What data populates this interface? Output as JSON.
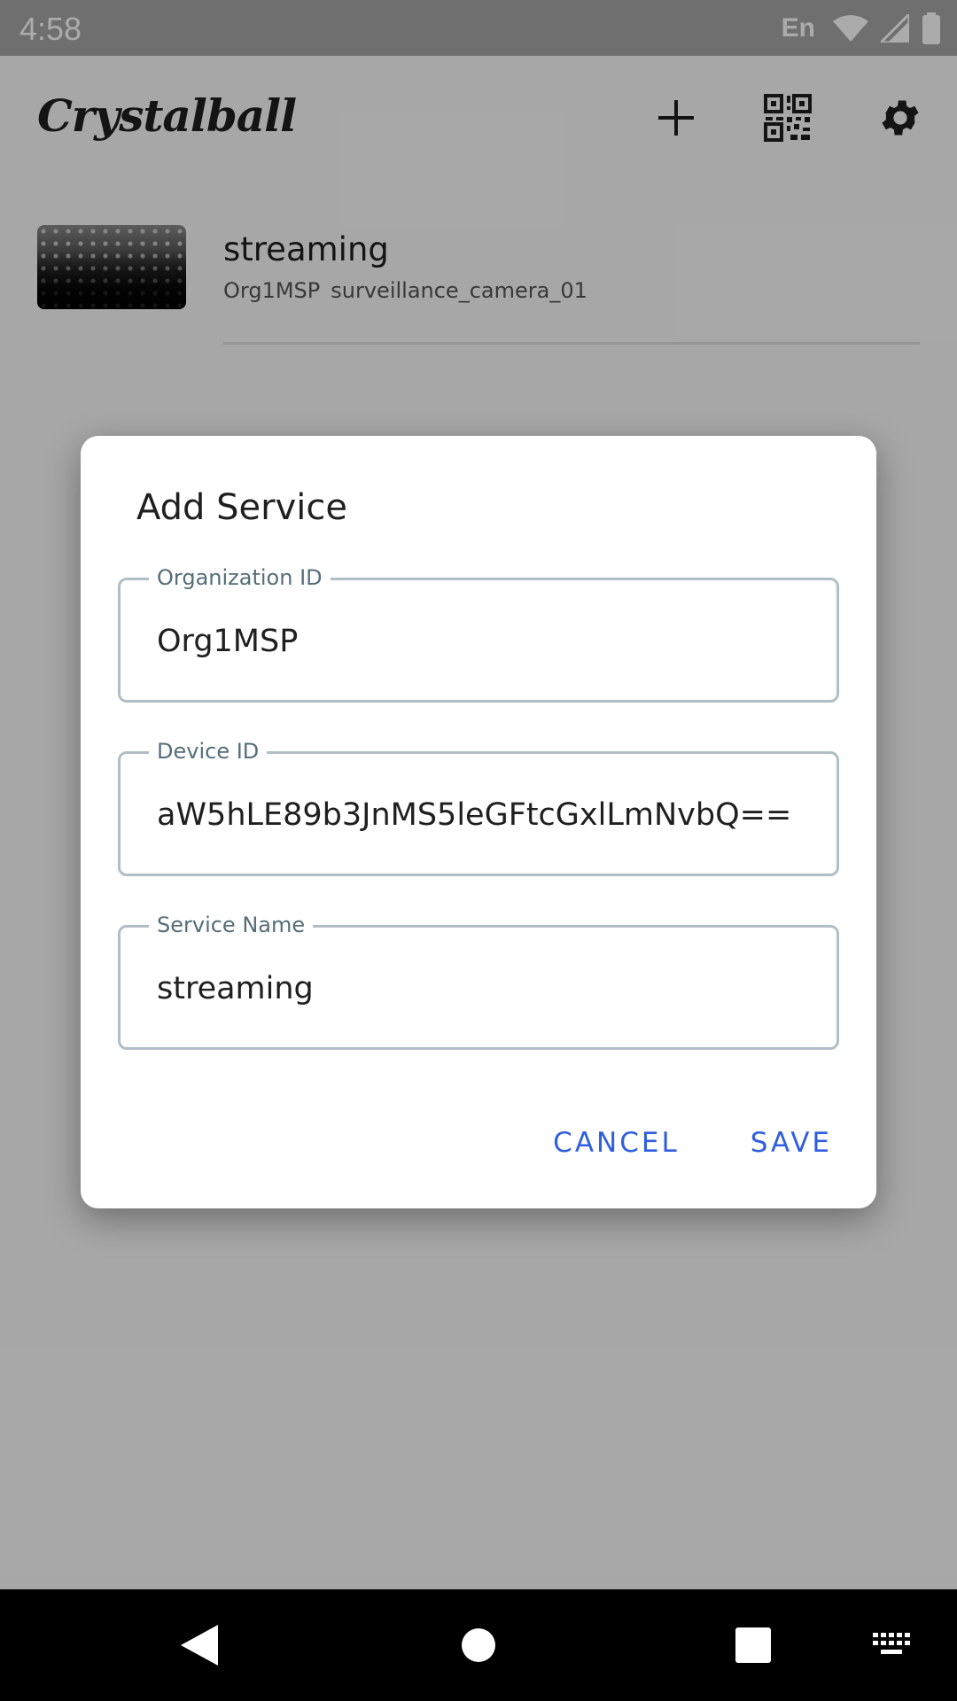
{
  "status_bar": {
    "time": "4:58",
    "language": "En",
    "icons": [
      "wifi-icon",
      "cell-signal-icon",
      "battery-icon"
    ]
  },
  "app": {
    "title": "Crystalball",
    "actions": [
      "add-icon",
      "qr-code-icon",
      "settings-icon"
    ]
  },
  "service_list": [
    {
      "title": "streaming",
      "organization": "Org1MSP",
      "device": "surveillance_camera_01"
    }
  ],
  "dialog": {
    "title": "Add Service",
    "fields": {
      "organization_id": {
        "label": "Organization ID",
        "value": "Org1MSP"
      },
      "device_id": {
        "label": "Device ID",
        "value": "aW5hLE89b3JnMS5leGFtcGxlLmNvbQ=="
      },
      "service_name": {
        "label": "Service Name",
        "value": "streaming"
      }
    },
    "cancel_label": "CANCEL",
    "save_label": "SAVE"
  },
  "nav_bar": {
    "buttons": [
      "back-icon",
      "home-icon",
      "recents-icon",
      "keyboard-icon"
    ]
  },
  "colors": {
    "accent": "#2f5fe0",
    "field_border": "#b0bec5",
    "field_label": "#546e7a",
    "scrim": "rgba(0,0,0,0.33)"
  }
}
